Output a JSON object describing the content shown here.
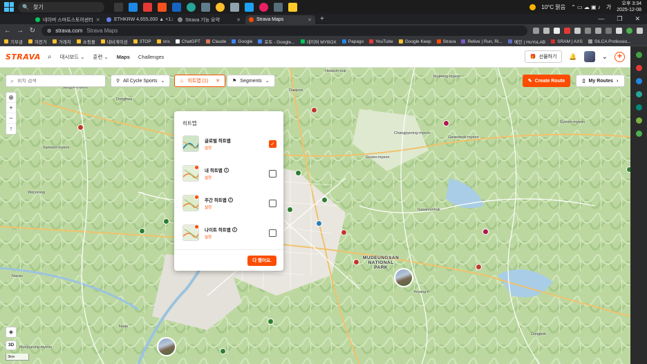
{
  "taskbar": {
    "search_placeholder": "찾기",
    "weather": "10°C 맑음",
    "clock_time": "오후 3:34",
    "clock_date": "2025-12-08",
    "lang": "가"
  },
  "browser": {
    "tabs": [
      {
        "label": "네이버 스마트스토어센터",
        "color": "#03c75a"
      },
      {
        "label": "ETHKRW 4,655,000 ▲ +1.59%",
        "color": "#627eea"
      },
      {
        "label": "Strava 기능 요약",
        "color": "#888888"
      },
      {
        "label": "Strava Maps",
        "color": "#fc4c02",
        "active": true
      }
    ],
    "url": "strava.com",
    "url_title": "Strava Maps",
    "bookmarks": [
      "기부금",
      "자전거",
      "거래처",
      "쇼핑몰",
      "네비게이션",
      "3TOP",
      "sns",
      "ChatGPT",
      "Claude",
      "Google",
      "포토 - Google...",
      "네이버 MYBOX",
      "Papago",
      "YouTube",
      "Google Keep",
      "Strava",
      "Relive | Run, Ri...",
      "메인 | HoYoLAB",
      "SRAM | AXS",
      "SILCA Professio..."
    ]
  },
  "header": {
    "logo": "STRAVA",
    "nav": [
      "대시보드",
      "훈련",
      "Maps",
      "Challenges"
    ],
    "gift": "선물하기"
  },
  "map_controls": {
    "search_placeholder": "위치 검색",
    "sport": "All Cycle Sports",
    "heatmap_chip": "히트맵 (1)",
    "segments": "Segments",
    "create_route": "Create Route",
    "my_routes": "My Routes",
    "btn3d": "3D",
    "scale": "3km"
  },
  "heatmap_panel": {
    "title": "히트맵",
    "items": [
      {
        "label": "글로벌 히트맵",
        "sub": "설정",
        "info": false,
        "checked": true
      },
      {
        "label": "내 히트맵",
        "sub": "설정",
        "info": true,
        "checked": false
      },
      {
        "label": "주간 히트맵",
        "sub": "설정",
        "info": true,
        "checked": false
      },
      {
        "label": "나이트 히트맵",
        "sub": "설정",
        "info": true,
        "checked": false
      }
    ],
    "done": "다 했어요."
  },
  "places": [
    "Daejeon",
    "Mujeong-myeon",
    "Donghwa",
    "Sangye-myeon",
    "Samseo-myeon",
    "Hwasun-eup",
    "Gyeom-myeon",
    "Changpyeong-myeon",
    "Gwaedeok-myeon",
    "Goseo-myeon",
    "Gasamunhak",
    "MUDEUNGSAN NATIONAL PARK",
    "Nasan",
    "Noan",
    "Munpyeong-myeon",
    "Dongbok",
    "Hwasun-eup",
    "Woryeong",
    "Gwangju",
    "Bukgu",
    "Buk-ri",
    "Yeyang-ri"
  ]
}
